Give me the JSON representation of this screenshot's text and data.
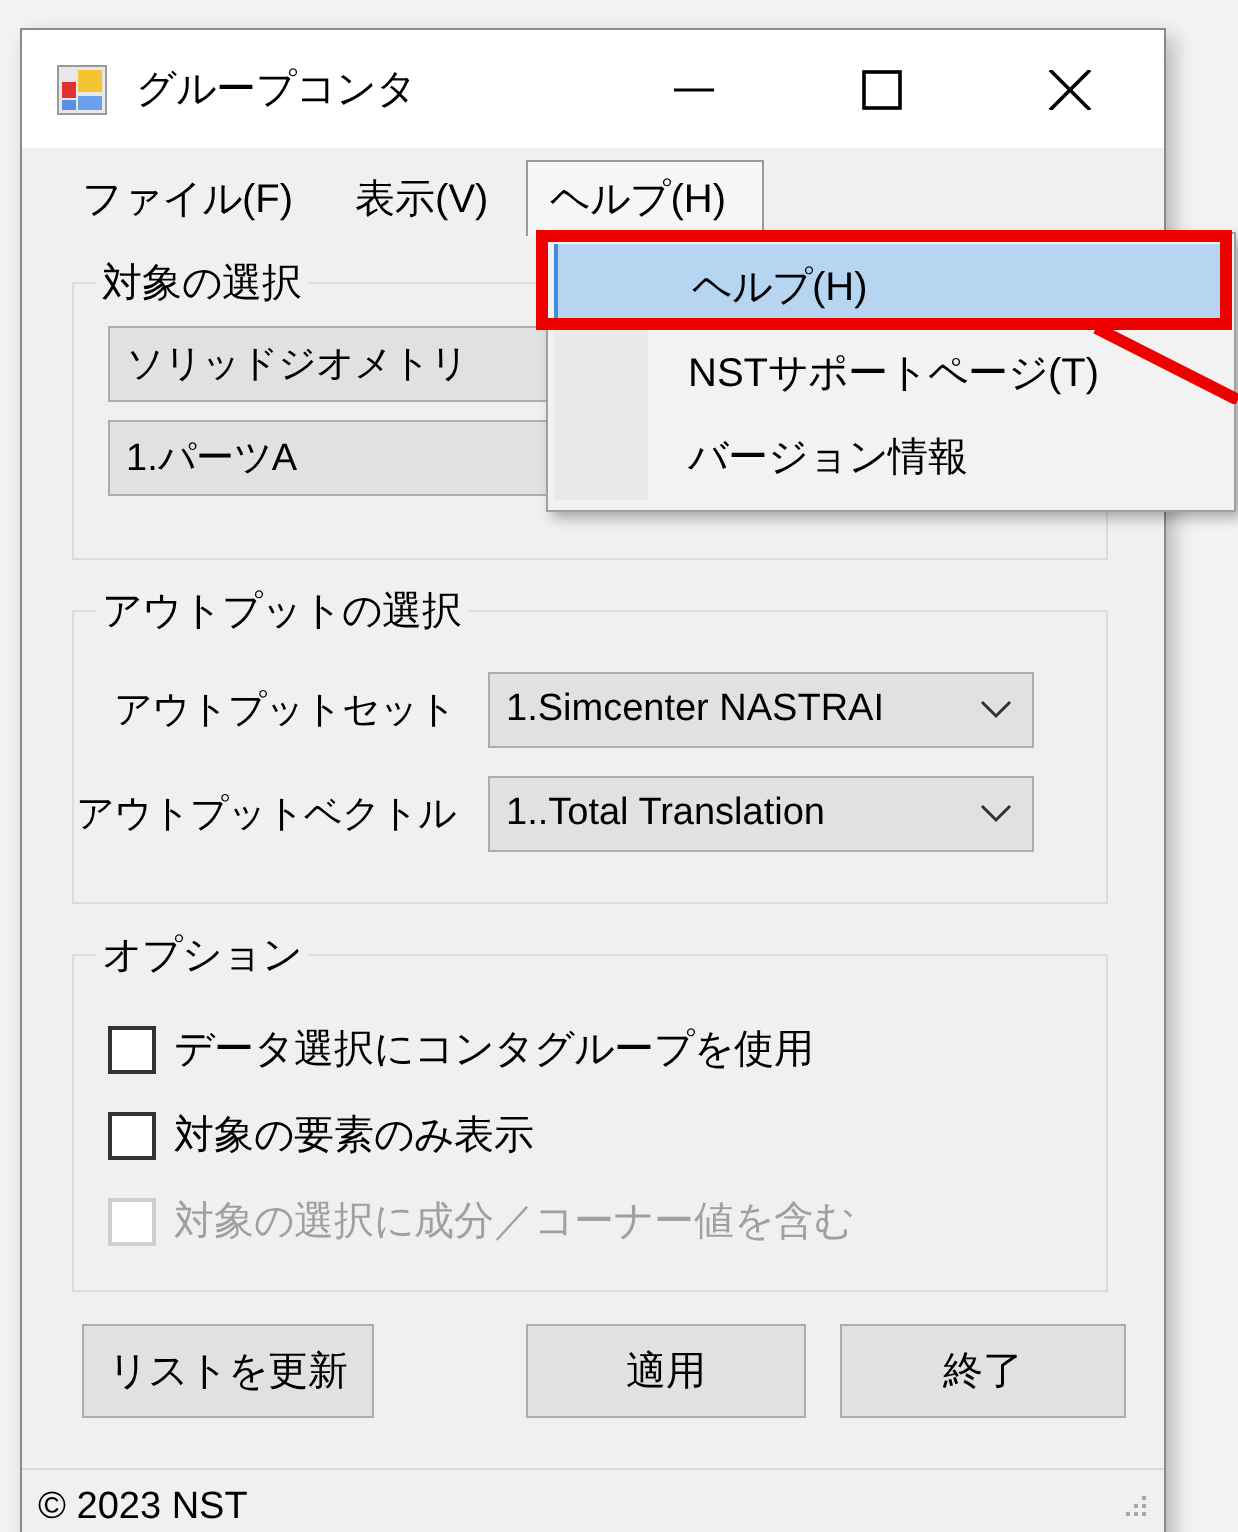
{
  "window": {
    "title": "グループコンタ"
  },
  "menu_bar": [
    {
      "label": "ファイル(F)",
      "open": false
    },
    {
      "label": "表示(V)",
      "open": false
    },
    {
      "label": "ヘルプ(H)",
      "open": true
    }
  ],
  "menu_popup": {
    "items": [
      {
        "label": "ヘルプ(H)",
        "selected": true
      },
      {
        "label": "NSTサポートページ(T)",
        "selected": false
      },
      {
        "label": "バージョン情報",
        "selected": false
      }
    ]
  },
  "groups": [
    {
      "title": "対象の選択",
      "kind": "combos",
      "combos": [
        {
          "value": "ソリッドジオメトリ"
        },
        {
          "value": "1.パーツA"
        }
      ]
    },
    {
      "title": "アウトプットの選択",
      "kind": "labeled_combos",
      "rows": [
        {
          "label": "アウトプットセット",
          "value": "1.Simcenter NASTRAI"
        },
        {
          "label": "アウトプットベクトル",
          "value": "1..Total Translation"
        }
      ]
    },
    {
      "title": "オプション",
      "kind": "checks",
      "checks": [
        {
          "label": "データ選択にコンタグループを使用",
          "checked": false,
          "disabled": false
        },
        {
          "label": "対象の要素のみ表示",
          "checked": false,
          "disabled": false
        },
        {
          "label": "対象の選択に成分／コーナー値を含む",
          "checked": false,
          "disabled": true
        }
      ]
    }
  ],
  "buttons": [
    "リストを更新",
    "適用",
    "終了"
  ],
  "status_bar": {
    "text": "© 2023 NST"
  }
}
